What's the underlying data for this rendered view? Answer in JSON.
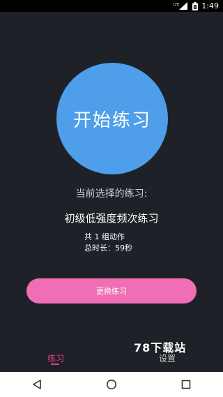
{
  "status_bar": {
    "network_label": "LTE",
    "battery_label": "8",
    "time": "1:49"
  },
  "main": {
    "start_button_label": "开始练习",
    "current_selection_label": "当前选择的练习:",
    "exercise_name": "初级低强度频次练习",
    "group_count_text": "共 1 组动作",
    "total_duration_text": "总时长：59秒",
    "change_button_label": "更换练习"
  },
  "watermark": "78下载站",
  "tabs": [
    {
      "label": "练习",
      "active": true
    },
    {
      "label": "设置",
      "active": false
    }
  ],
  "nav": {
    "back": "back-icon",
    "home": "home-icon",
    "recents": "recents-icon"
  },
  "colors": {
    "background": "#1e2127",
    "circle": "#4e9eea",
    "change_button": "#f06fb4",
    "active_tab": "#e33f7a"
  }
}
